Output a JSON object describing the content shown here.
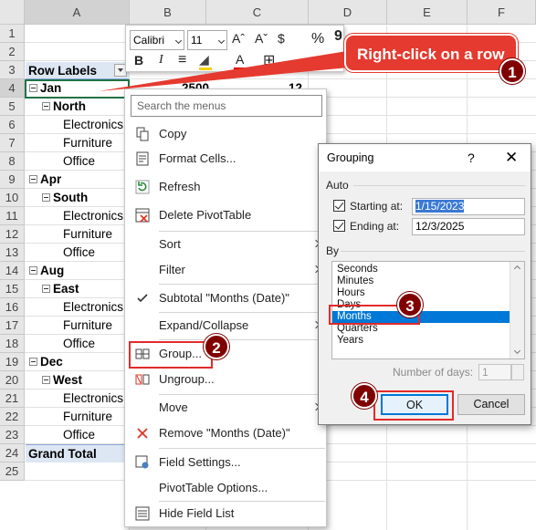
{
  "sheet": {
    "columns": [
      "A",
      "B",
      "C",
      "D",
      "E",
      "F"
    ],
    "rows": [
      "1",
      "2",
      "3",
      "4",
      "5",
      "6",
      "7",
      "8",
      "9",
      "10",
      "11",
      "12",
      "13",
      "14",
      "15",
      "16",
      "17",
      "18",
      "19",
      "20",
      "21",
      "22",
      "23",
      "24",
      "25"
    ]
  },
  "pivot": {
    "header": "Row Labels",
    "rows": [
      {
        "label": "Jan",
        "level": 0
      },
      {
        "label": "North",
        "level": 1
      },
      {
        "label": "Electronics",
        "level": 2
      },
      {
        "label": "Furniture",
        "level": 2
      },
      {
        "label": "Office",
        "level": 2
      },
      {
        "label": "Apr",
        "level": 0
      },
      {
        "label": "South",
        "level": 1
      },
      {
        "label": "Electronics",
        "level": 2
      },
      {
        "label": "Furniture",
        "level": 2
      },
      {
        "label": "Office",
        "level": 2
      },
      {
        "label": "Aug",
        "level": 0
      },
      {
        "label": "East",
        "level": 1
      },
      {
        "label": "Electronics",
        "level": 2
      },
      {
        "label": "Furniture",
        "level": 2
      },
      {
        "label": "Office",
        "level": 2
      },
      {
        "label": "Dec",
        "level": 0
      },
      {
        "label": "West",
        "level": 1
      },
      {
        "label": "Electronics",
        "level": 2
      },
      {
        "label": "Furniture",
        "level": 2
      },
      {
        "label": "Office",
        "level": 2
      }
    ],
    "grand_total": "Grand Total",
    "partial_values": [
      "2500",
      "12"
    ]
  },
  "minibar": {
    "font": "Calibri",
    "size": "11",
    "grow_icon": "Aˆ",
    "shrink_icon": "Aˇ",
    "currency": "$",
    "percent": "%",
    "comma": "9",
    "bold": "B",
    "italic": "I",
    "align": "≡",
    "fill_icon": "◢",
    "font_color": "A",
    "borders": "⊞"
  },
  "context_menu": {
    "search_placeholder": "Search the menus",
    "items": [
      {
        "label": "Copy"
      },
      {
        "label": "Format Cells..."
      },
      {
        "label": "Refresh"
      },
      {
        "label": "Delete PivotTable"
      },
      {
        "label": "Sort"
      },
      {
        "label": "Filter"
      },
      {
        "label": "Subtotal \"Months (Date)\""
      },
      {
        "label": "Expand/Collapse"
      },
      {
        "label": "Group..."
      },
      {
        "label": "Ungroup..."
      },
      {
        "label": "Move"
      },
      {
        "label": "Remove \"Months (Date)\""
      },
      {
        "label": "Field Settings..."
      },
      {
        "label": "PivotTable Options..."
      },
      {
        "label": "Hide Field List"
      }
    ]
  },
  "dialog": {
    "title": "Grouping",
    "help": "?",
    "close": "✕",
    "auto_label": "Auto",
    "starting_label": "Starting at:",
    "starting_value": "1/15/2023",
    "ending_label": "Ending at:",
    "ending_value": "12/3/2025",
    "by_label": "By",
    "by_options": [
      "Seconds",
      "Minutes",
      "Hours",
      "Days",
      "Months",
      "Quarters",
      "Years"
    ],
    "selected_option": "Months",
    "num_days_label": "Number of days:",
    "num_days_value": "1",
    "ok": "OK",
    "cancel": "Cancel"
  },
  "annotations": {
    "callout_text": "Right-click on a row",
    "steps": [
      "1",
      "2",
      "3",
      "4"
    ],
    "accent": "#800000",
    "callout_color": "#e53a2f"
  }
}
